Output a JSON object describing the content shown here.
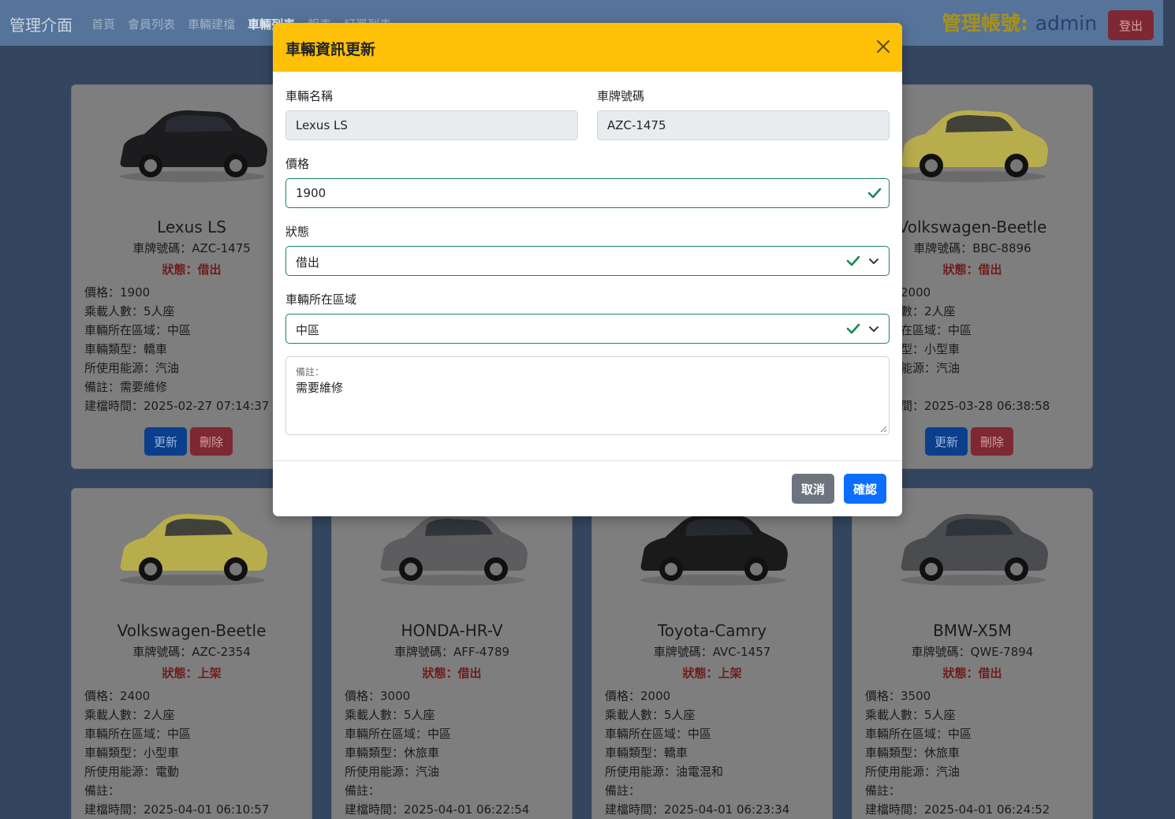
{
  "nav": {
    "brand": "管理介面",
    "links": [
      "首頁",
      "會員列表",
      "車輛建檔",
      "車輛列表",
      "報表",
      "訂單列表"
    ],
    "admin_prefix": "管理帳號:",
    "admin_name": "admin",
    "logout": "登出"
  },
  "cards": [
    {
      "name": "Lexus LS",
      "plate": "車牌號碼：AZC-1475",
      "status": "狀態：借出",
      "price": "價格：1900",
      "seats": "乘載人數：5人座",
      "region": "車輛所在區域：中區",
      "type": "車輛類型：轎車",
      "energy": "所使用能源：汽油",
      "note": "備註：需要維修",
      "created": "建檔時間：2025-02-27 07:14:37",
      "car_color": "#1c1c1e",
      "update": "更新",
      "delete": "刪除"
    },
    {
      "name": "Volkswagen-Beetle",
      "plate": "車牌號碼：BBC-8896",
      "status": "狀態：借出",
      "price": "價格：2000",
      "seats": "乘載人數：2人座",
      "region": "車輛所在區域：中區",
      "type": "車輛類型：小型車",
      "energy": "所使用能源：汽油",
      "note": "備註：",
      "created": "建檔時間：2025-03-28 06:38:58",
      "car_color": "#b8ad4c",
      "update": "更新",
      "delete": "刪除"
    },
    {
      "name": "Volkswagen-Beetle",
      "plate": "車牌號碼：AZC-2354",
      "status": "狀態：上架",
      "price": "價格：2400",
      "seats": "乘載人數：2人座",
      "region": "車輛所在區域：中區",
      "type": "車輛類型：小型車",
      "energy": "所使用能源：電動",
      "note": "備註：",
      "created": "建檔時間：2025-04-01 06:10:57",
      "car_color": "#b8ad4c"
    },
    {
      "name": "HONDA-HR-V",
      "plate": "車牌號碼：AFF-4789",
      "status": "狀態：借出",
      "price": "價格：3000",
      "seats": "乘載人數：5人座",
      "region": "車輛所在區域：中區",
      "type": "車輛類型：休旅車",
      "energy": "所使用能源：汽油",
      "note": "備註：",
      "created": "建檔時間：2025-04-01 06:22:54",
      "car_color": "#5d5d5f"
    },
    {
      "name": "Toyota-Camry",
      "plate": "車牌號碼：AVC-1457",
      "status": "狀態：上架",
      "price": "價格：2000",
      "seats": "乘載人數：5人座",
      "region": "車輛所在區域：中區",
      "type": "車輛類型：轎車",
      "energy": "所使用能源：油電混和",
      "note": "備註：",
      "created": "建檔時間：2025-04-01 06:23:34",
      "car_color": "#1a1a1a"
    },
    {
      "name": "BMW-X5M",
      "plate": "車牌號碼：QWE-7894",
      "status": "狀態：借出",
      "price": "價格：3500",
      "seats": "乘載人數：5人座",
      "region": "車輛所在區域：中區",
      "type": "車輛類型：休旅車",
      "energy": "所使用能源：汽油",
      "note": "備註：",
      "created": "建檔時間：2025-04-01 06:24:52",
      "car_color": "#4a4c4f"
    }
  ],
  "modal": {
    "title": "車輛資訊更新",
    "name_label": "車輛名稱",
    "name_value": "Lexus LS",
    "plate_label": "車牌號碼",
    "plate_value": "AZC-1475",
    "price_label": "價格",
    "price_value": "1900",
    "status_label": "狀態",
    "status_value": "借出",
    "region_label": "車輛所在區域",
    "region_value": "中區",
    "notes_label": "備註：",
    "notes_value": "需要維修",
    "cancel": "取消",
    "confirm": "確認"
  },
  "colors": {
    "modal_header": "#ffc107",
    "valid_green": "#198754",
    "primary": "#0d6efd",
    "secondary": "#6c757d"
  }
}
